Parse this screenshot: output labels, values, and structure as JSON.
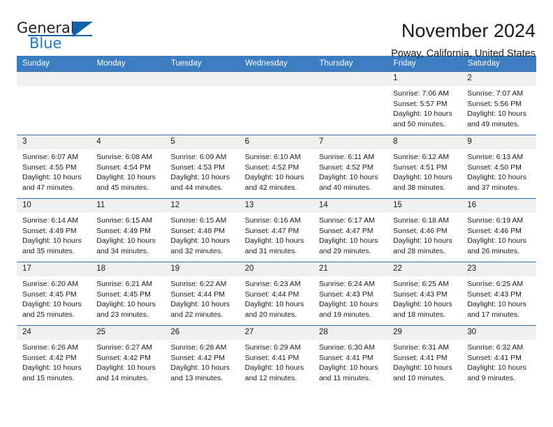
{
  "brand": {
    "name_part1": "General",
    "name_part2": "Blue",
    "triangle_color": "#1163a8"
  },
  "header": {
    "month_title": "November 2024",
    "location": "Poway, California, United States"
  },
  "theme": {
    "header_bg": "#3b7dc0",
    "daynum_bg": "#f0f0f0",
    "border": "#2f6fad"
  },
  "calendar": {
    "weekday_headers": [
      "Sunday",
      "Monday",
      "Tuesday",
      "Wednesday",
      "Thursday",
      "Friday",
      "Saturday"
    ],
    "weeks": [
      [
        {
          "day": "",
          "empty": true
        },
        {
          "day": "",
          "empty": true
        },
        {
          "day": "",
          "empty": true
        },
        {
          "day": "",
          "empty": true
        },
        {
          "day": "",
          "empty": true
        },
        {
          "day": "1",
          "sunrise": "Sunrise: 7:06 AM",
          "sunset": "Sunset: 5:57 PM",
          "daylight": "Daylight: 10 hours and 50 minutes."
        },
        {
          "day": "2",
          "sunrise": "Sunrise: 7:07 AM",
          "sunset": "Sunset: 5:56 PM",
          "daylight": "Daylight: 10 hours and 49 minutes."
        }
      ],
      [
        {
          "day": "3",
          "sunrise": "Sunrise: 6:07 AM",
          "sunset": "Sunset: 4:55 PM",
          "daylight": "Daylight: 10 hours and 47 minutes."
        },
        {
          "day": "4",
          "sunrise": "Sunrise: 6:08 AM",
          "sunset": "Sunset: 4:54 PM",
          "daylight": "Daylight: 10 hours and 45 minutes."
        },
        {
          "day": "5",
          "sunrise": "Sunrise: 6:09 AM",
          "sunset": "Sunset: 4:53 PM",
          "daylight": "Daylight: 10 hours and 44 minutes."
        },
        {
          "day": "6",
          "sunrise": "Sunrise: 6:10 AM",
          "sunset": "Sunset: 4:52 PM",
          "daylight": "Daylight: 10 hours and 42 minutes."
        },
        {
          "day": "7",
          "sunrise": "Sunrise: 6:11 AM",
          "sunset": "Sunset: 4:52 PM",
          "daylight": "Daylight: 10 hours and 40 minutes."
        },
        {
          "day": "8",
          "sunrise": "Sunrise: 6:12 AM",
          "sunset": "Sunset: 4:51 PM",
          "daylight": "Daylight: 10 hours and 38 minutes."
        },
        {
          "day": "9",
          "sunrise": "Sunrise: 6:13 AM",
          "sunset": "Sunset: 4:50 PM",
          "daylight": "Daylight: 10 hours and 37 minutes."
        }
      ],
      [
        {
          "day": "10",
          "sunrise": "Sunrise: 6:14 AM",
          "sunset": "Sunset: 4:49 PM",
          "daylight": "Daylight: 10 hours and 35 minutes."
        },
        {
          "day": "11",
          "sunrise": "Sunrise: 6:15 AM",
          "sunset": "Sunset: 4:49 PM",
          "daylight": "Daylight: 10 hours and 34 minutes."
        },
        {
          "day": "12",
          "sunrise": "Sunrise: 6:15 AM",
          "sunset": "Sunset: 4:48 PM",
          "daylight": "Daylight: 10 hours and 32 minutes."
        },
        {
          "day": "13",
          "sunrise": "Sunrise: 6:16 AM",
          "sunset": "Sunset: 4:47 PM",
          "daylight": "Daylight: 10 hours and 31 minutes."
        },
        {
          "day": "14",
          "sunrise": "Sunrise: 6:17 AM",
          "sunset": "Sunset: 4:47 PM",
          "daylight": "Daylight: 10 hours and 29 minutes."
        },
        {
          "day": "15",
          "sunrise": "Sunrise: 6:18 AM",
          "sunset": "Sunset: 4:46 PM",
          "daylight": "Daylight: 10 hours and 28 minutes."
        },
        {
          "day": "16",
          "sunrise": "Sunrise: 6:19 AM",
          "sunset": "Sunset: 4:46 PM",
          "daylight": "Daylight: 10 hours and 26 minutes."
        }
      ],
      [
        {
          "day": "17",
          "sunrise": "Sunrise: 6:20 AM",
          "sunset": "Sunset: 4:45 PM",
          "daylight": "Daylight: 10 hours and 25 minutes."
        },
        {
          "day": "18",
          "sunrise": "Sunrise: 6:21 AM",
          "sunset": "Sunset: 4:45 PM",
          "daylight": "Daylight: 10 hours and 23 minutes."
        },
        {
          "day": "19",
          "sunrise": "Sunrise: 6:22 AM",
          "sunset": "Sunset: 4:44 PM",
          "daylight": "Daylight: 10 hours and 22 minutes."
        },
        {
          "day": "20",
          "sunrise": "Sunrise: 6:23 AM",
          "sunset": "Sunset: 4:44 PM",
          "daylight": "Daylight: 10 hours and 20 minutes."
        },
        {
          "day": "21",
          "sunrise": "Sunrise: 6:24 AM",
          "sunset": "Sunset: 4:43 PM",
          "daylight": "Daylight: 10 hours and 19 minutes."
        },
        {
          "day": "22",
          "sunrise": "Sunrise: 6:25 AM",
          "sunset": "Sunset: 4:43 PM",
          "daylight": "Daylight: 10 hours and 18 minutes."
        },
        {
          "day": "23",
          "sunrise": "Sunrise: 6:25 AM",
          "sunset": "Sunset: 4:43 PM",
          "daylight": "Daylight: 10 hours and 17 minutes."
        }
      ],
      [
        {
          "day": "24",
          "sunrise": "Sunrise: 6:26 AM",
          "sunset": "Sunset: 4:42 PM",
          "daylight": "Daylight: 10 hours and 15 minutes."
        },
        {
          "day": "25",
          "sunrise": "Sunrise: 6:27 AM",
          "sunset": "Sunset: 4:42 PM",
          "daylight": "Daylight: 10 hours and 14 minutes."
        },
        {
          "day": "26",
          "sunrise": "Sunrise: 6:28 AM",
          "sunset": "Sunset: 4:42 PM",
          "daylight": "Daylight: 10 hours and 13 minutes."
        },
        {
          "day": "27",
          "sunrise": "Sunrise: 6:29 AM",
          "sunset": "Sunset: 4:41 PM",
          "daylight": "Daylight: 10 hours and 12 minutes."
        },
        {
          "day": "28",
          "sunrise": "Sunrise: 6:30 AM",
          "sunset": "Sunset: 4:41 PM",
          "daylight": "Daylight: 10 hours and 11 minutes."
        },
        {
          "day": "29",
          "sunrise": "Sunrise: 6:31 AM",
          "sunset": "Sunset: 4:41 PM",
          "daylight": "Daylight: 10 hours and 10 minutes."
        },
        {
          "day": "30",
          "sunrise": "Sunrise: 6:32 AM",
          "sunset": "Sunset: 4:41 PM",
          "daylight": "Daylight: 10 hours and 9 minutes."
        }
      ]
    ]
  }
}
